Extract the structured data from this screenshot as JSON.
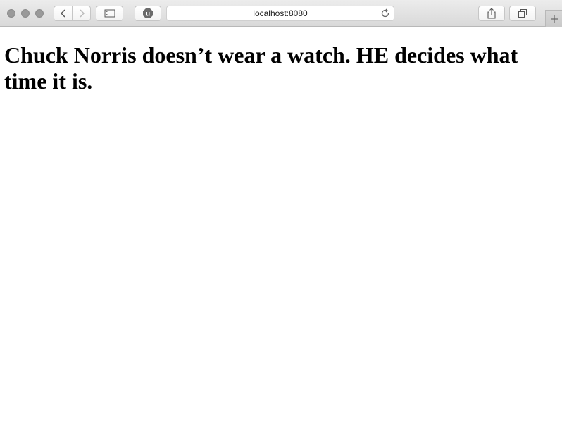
{
  "browser": {
    "address_bar": {
      "url": "localhost:8080"
    },
    "extension_badge": "u",
    "icons": {
      "back": "chevron-left-icon",
      "forward": "chevron-right-icon",
      "sidebar": "sidebar-icon",
      "reload": "reload-icon",
      "share": "share-icon",
      "tabs": "tabs-icon",
      "new_tab": "plus-icon"
    }
  },
  "page": {
    "heading": "Chuck Norris doesn’t wear a watch. HE decides what time it is."
  }
}
